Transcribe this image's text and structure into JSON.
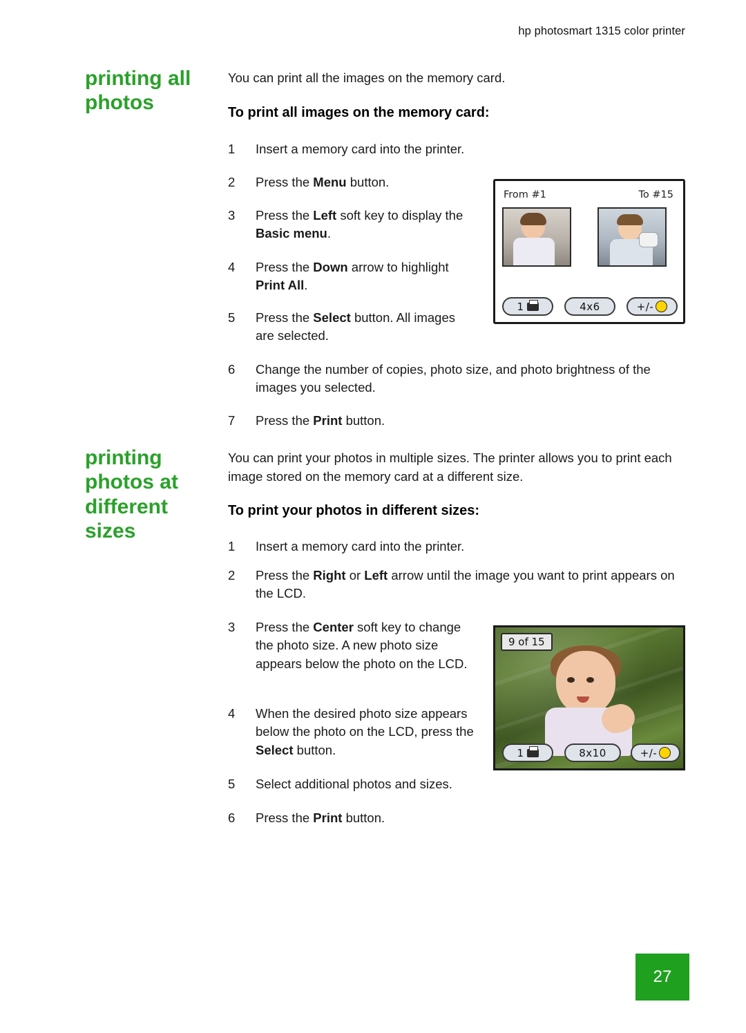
{
  "header": {
    "running_title": "hp photosmart 1315 color printer"
  },
  "sections": [
    {
      "side_heading": "printing all photos",
      "intro": "You can print all the images on the memory card.",
      "sub_heading": "To print all images on the memory card:",
      "steps": [
        {
          "num": "1",
          "html": "Insert a memory card into the printer."
        },
        {
          "num": "2",
          "html": "Press the <b>Menu</b> button."
        },
        {
          "num": "3",
          "html": "Press the <b>Left</b> soft key to display the <b>Basic menu</b>."
        },
        {
          "num": "4",
          "html": "Press the <b>Down</b> arrow to highlight <b>Print All</b>."
        },
        {
          "num": "5",
          "html": "Press the <b>Select</b> button. All images are selected."
        },
        {
          "num": "6",
          "html": "Change the number of copies, photo size, and photo brightness of the images you selected."
        },
        {
          "num": "7",
          "html": "Press the <b>Print</b> button."
        }
      ]
    },
    {
      "side_heading": "printing photos at different sizes",
      "intro": "You can print your photos in multiple sizes. The printer allows you to print each image stored on the memory card at a different size.",
      "sub_heading": "To print your photos in different sizes:",
      "steps": [
        {
          "num": "1",
          "html": "Insert a memory card into the printer."
        },
        {
          "num": "2",
          "html": "Press the <b>Right</b> or <b>Left</b> arrow until the image you want to print appears on the LCD."
        },
        {
          "num": "3",
          "html": "Press the <b>Center</b> soft key to change the photo size. A new photo size appears below the photo on the LCD."
        },
        {
          "num": "4",
          "html": "When the desired photo size appears below the photo on the LCD, press the <b>Select</b> button."
        },
        {
          "num": "5",
          "html": "Select additional photos and sizes."
        },
        {
          "num": "6",
          "html": "Press the <b>Print</b> button."
        }
      ]
    }
  ],
  "lcd_range_screen": {
    "from_label": "From #1",
    "to_label": "To #15",
    "copies": "1",
    "size": "4x6",
    "brightness": "+/-"
  },
  "lcd_photo_screen": {
    "counter": "9 of 15",
    "copies": "1",
    "size": "8x10",
    "brightness": "+/-"
  },
  "page_number": "27",
  "colors": {
    "heading_green": "#2aa12a",
    "page_box_green": "#1fa01f"
  }
}
